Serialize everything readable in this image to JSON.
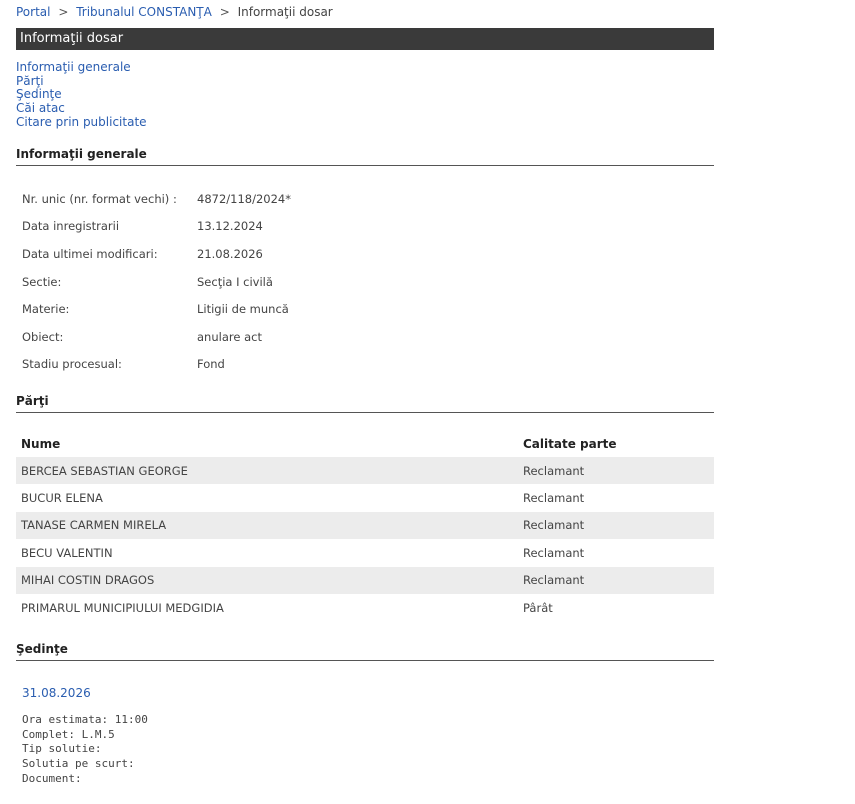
{
  "breadcrumb": {
    "portal": "Portal",
    "court": "Tribunalul CONSTANŢA",
    "current": "Informaţii dosar",
    "separator": ">"
  },
  "title_bar": "Informaţii dosar",
  "nav_links": [
    "Informaţii generale",
    "Părţi",
    "Şedinţe",
    "Căi atac",
    "Citare prin publicitate"
  ],
  "general": {
    "heading": "Informaţii generale",
    "rows": [
      {
        "label": "Nr. unic (nr. format vechi) :",
        "value": "4872/118/2024*"
      },
      {
        "label": "Data inregistrarii",
        "value": "13.12.2024"
      },
      {
        "label": "Data ultimei modificari:",
        "value": "21.08.2026"
      },
      {
        "label": "Sectie:",
        "value": "Secţia I civilă"
      },
      {
        "label": "Materie:",
        "value": "Litigii de muncă"
      },
      {
        "label": "Obiect:",
        "value": "anulare act"
      },
      {
        "label": "Stadiu procesual:",
        "value": "Fond"
      }
    ]
  },
  "parties": {
    "heading": "Părţi",
    "columns": [
      "Nume",
      "Calitate parte"
    ],
    "rows": [
      {
        "name": "BERCEA SEBASTIAN GEORGE",
        "role": "Reclamant"
      },
      {
        "name": "BUCUR ELENA",
        "role": "Reclamant"
      },
      {
        "name": "TANASE CARMEN MIRELA",
        "role": "Reclamant"
      },
      {
        "name": "BECU VALENTIN",
        "role": "Reclamant"
      },
      {
        "name": "MIHAI COSTIN DRAGOS",
        "role": "Reclamant"
      },
      {
        "name": "PRIMARUL MUNICIPIULUI MEDGIDIA",
        "role": "Pârât"
      }
    ]
  },
  "hearings": {
    "heading": "Şedinţe",
    "date": "31.08.2026",
    "details": [
      "Ora estimata: 11:00",
      "Complet: L.M.5",
      "Tip solutie:",
      "Solutia pe scurt:",
      "Document:"
    ]
  },
  "colors": {
    "link": "#2a5db0",
    "title_bar_bg": "#3a3a3a",
    "row_shade": "#ececec"
  }
}
